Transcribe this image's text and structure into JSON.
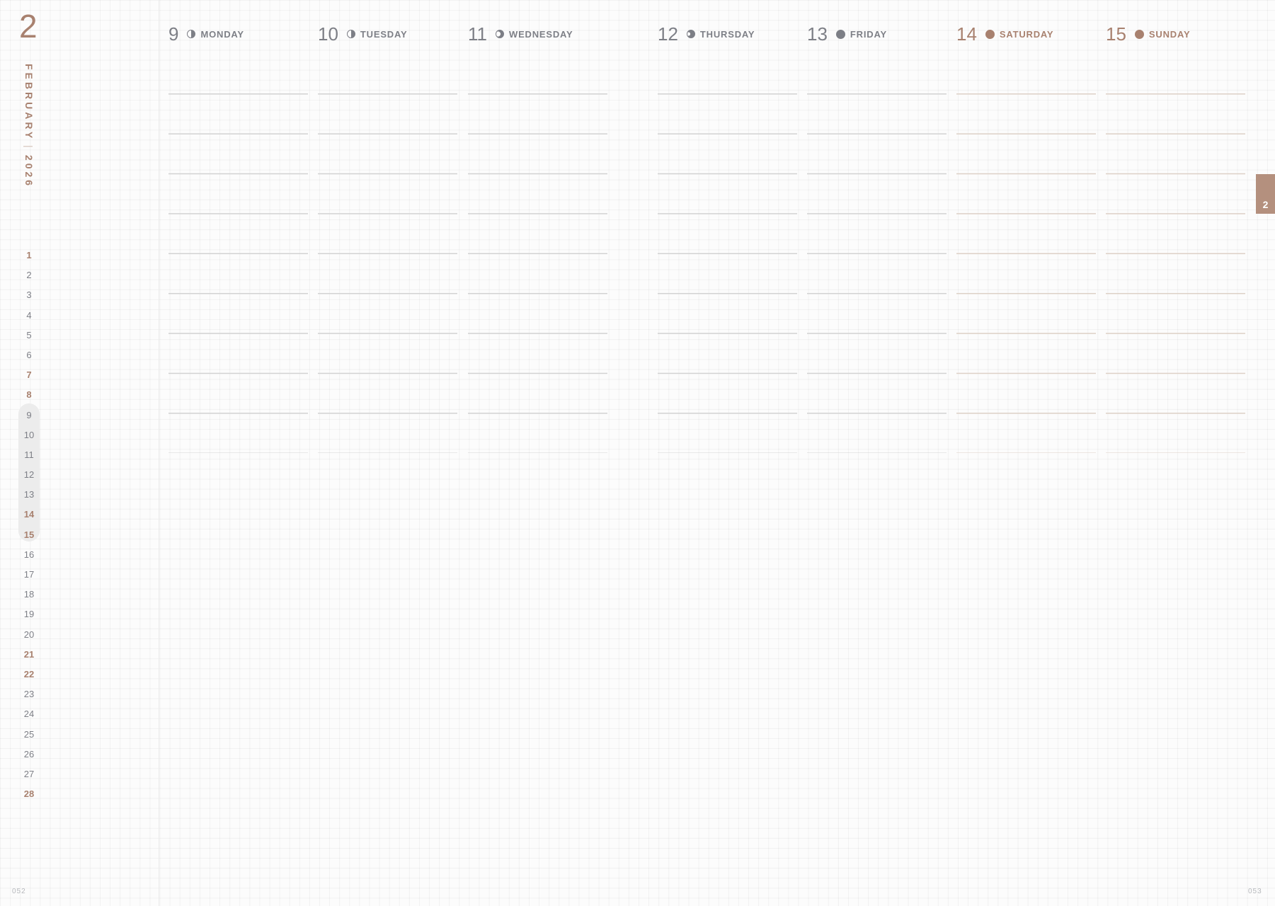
{
  "colors": {
    "accent": "#a8816f",
    "text": "#7d7f86",
    "tab": "#b4907e",
    "rule": "#d2d2d2",
    "highlight": "#ececec"
  },
  "sidebar": {
    "month_number": "2",
    "month_name": "FEBRUARY",
    "separator": "|",
    "year": "2026",
    "days": [
      {
        "n": "1",
        "weekend": true
      },
      {
        "n": "2",
        "weekend": false
      },
      {
        "n": "3",
        "weekend": false
      },
      {
        "n": "4",
        "weekend": false
      },
      {
        "n": "5",
        "weekend": false
      },
      {
        "n": "6",
        "weekend": false
      },
      {
        "n": "7",
        "weekend": true
      },
      {
        "n": "8",
        "weekend": true
      },
      {
        "n": "9",
        "weekend": false
      },
      {
        "n": "10",
        "weekend": false
      },
      {
        "n": "11",
        "weekend": false
      },
      {
        "n": "12",
        "weekend": false
      },
      {
        "n": "13",
        "weekend": false
      },
      {
        "n": "14",
        "weekend": true
      },
      {
        "n": "15",
        "weekend": true
      },
      {
        "n": "16",
        "weekend": false
      },
      {
        "n": "17",
        "weekend": false
      },
      {
        "n": "18",
        "weekend": false
      },
      {
        "n": "19",
        "weekend": false
      },
      {
        "n": "20",
        "weekend": false
      },
      {
        "n": "21",
        "weekend": true
      },
      {
        "n": "22",
        "weekend": true
      },
      {
        "n": "23",
        "weekend": false
      },
      {
        "n": "24",
        "weekend": false
      },
      {
        "n": "25",
        "weekend": false
      },
      {
        "n": "26",
        "weekend": false
      },
      {
        "n": "27",
        "weekend": false
      },
      {
        "n": "28",
        "weekend": true
      }
    ],
    "current_week": [
      "9",
      "10",
      "11",
      "12",
      "13",
      "14",
      "15"
    ]
  },
  "week": {
    "days": [
      {
        "date": "9",
        "name": "MONDAY",
        "moon": "first-quarter-moon-icon",
        "weekend": false
      },
      {
        "date": "10",
        "name": "TUESDAY",
        "moon": "first-quarter-moon-icon",
        "weekend": false
      },
      {
        "date": "11",
        "name": "WEDNESDAY",
        "moon": "waxing-gibbous-moon-icon",
        "weekend": false
      },
      {
        "date": "12",
        "name": "THURSDAY",
        "moon": "waxing-gibbous-moon-icon",
        "weekend": false
      },
      {
        "date": "13",
        "name": "FRIDAY",
        "moon": "full-moon-icon",
        "weekend": false
      },
      {
        "date": "14",
        "name": "SATURDAY",
        "moon": "full-moon-icon",
        "weekend": true
      },
      {
        "date": "15",
        "name": "SUNDAY",
        "moon": "full-moon-icon",
        "weekend": true
      }
    ]
  },
  "tab": {
    "label": "2"
  },
  "pages": {
    "left": "052",
    "right": "053"
  }
}
